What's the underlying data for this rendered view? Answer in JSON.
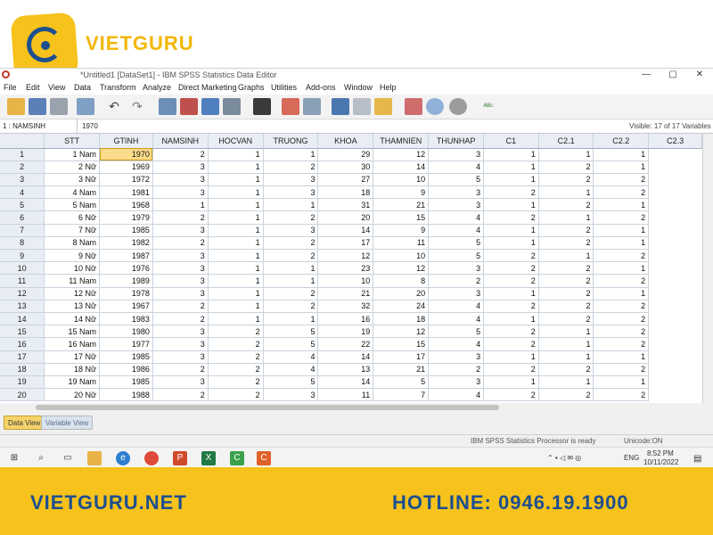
{
  "brand": {
    "name": "VIETGURU",
    "website": "VIETGURU.NET",
    "hotline": "HOTLINE: 0946.19.1900",
    "colors": {
      "yellow": "#f6c21b",
      "blue": "#1d4f8f"
    }
  },
  "window": {
    "title": "*Untitled1 [DataSet1] - IBM SPSS Statistics Data Editor",
    "controls": {
      "minimize": "—",
      "maximize": "▢",
      "close": "✕"
    }
  },
  "menu": [
    "File",
    "Edit",
    "View",
    "Data",
    "Transform",
    "Analyze",
    "Direct Marketing",
    "Graphs",
    "Utilities",
    "Add-ons",
    "Window",
    "Help"
  ],
  "toolbar_icons": [
    "open-folder-icon",
    "save-icon",
    "print-icon",
    "dialog-recall-icon",
    "undo-icon",
    "redo-icon",
    "goto-case-icon",
    "goto-variable-icon",
    "variables-icon",
    "run-descriptives-icon",
    "find-icon",
    "insert-cases-icon",
    "insert-variable-icon",
    "split-file-icon",
    "weight-cases-icon",
    "select-cases-icon",
    "value-labels-icon",
    "use-sets-icon",
    "show-all-icon",
    "spelling-icon"
  ],
  "cell_editor": {
    "reference": "1 : NAMSINH",
    "value": "1970",
    "visible_label": "Visible: 17 of 17 Variables"
  },
  "grid": {
    "columns": [
      "STT",
      "GTINH",
      "NAMSINH",
      "HOCVAN",
      "TRUONG",
      "KHOA",
      "THAMNIEN",
      "THUNHAP",
      "C1",
      "C2.1",
      "C2.2",
      "C2.3"
    ],
    "selected": {
      "row": 1,
      "column": "NAMSINH"
    },
    "rows": [
      [
        "1 Nam",
        "1970",
        "2",
        "1",
        "1",
        "29",
        "12",
        "3",
        "1",
        "1",
        "1"
      ],
      [
        "2 Nữ",
        "1969",
        "3",
        "1",
        "2",
        "30",
        "14",
        "4",
        "1",
        "2",
        "1"
      ],
      [
        "3 Nữ",
        "1972",
        "3",
        "1",
        "3",
        "27",
        "10",
        "5",
        "1",
        "2",
        "2"
      ],
      [
        "4 Nam",
        "1981",
        "3",
        "1",
        "3",
        "18",
        "9",
        "3",
        "2",
        "1",
        "2"
      ],
      [
        "5 Nam",
        "1968",
        "1",
        "1",
        "1",
        "31",
        "21",
        "3",
        "1",
        "2",
        "1"
      ],
      [
        "6 Nữ",
        "1979",
        "2",
        "1",
        "2",
        "20",
        "15",
        "4",
        "2",
        "1",
        "2"
      ],
      [
        "7 Nữ",
        "1985",
        "3",
        "1",
        "3",
        "14",
        "9",
        "4",
        "1",
        "2",
        "1"
      ],
      [
        "8 Nam",
        "1982",
        "2",
        "1",
        "2",
        "17",
        "11",
        "5",
        "1",
        "2",
        "1"
      ],
      [
        "9 Nữ",
        "1987",
        "3",
        "1",
        "2",
        "12",
        "10",
        "5",
        "2",
        "1",
        "2"
      ],
      [
        "10 Nữ",
        "1976",
        "3",
        "1",
        "1",
        "23",
        "12",
        "3",
        "2",
        "2",
        "1"
      ],
      [
        "11 Nam",
        "1989",
        "3",
        "1",
        "1",
        "10",
        "8",
        "2",
        "2",
        "2",
        "2"
      ],
      [
        "12 Nữ",
        "1978",
        "3",
        "1",
        "2",
        "21",
        "20",
        "3",
        "1",
        "2",
        "1"
      ],
      [
        "13 Nữ",
        "1967",
        "2",
        "1",
        "2",
        "32",
        "24",
        "4",
        "2",
        "2",
        "2"
      ],
      [
        "14 Nữ",
        "1983",
        "2",
        "1",
        "1",
        "16",
        "18",
        "4",
        "1",
        "2",
        "2"
      ],
      [
        "15 Nam",
        "1980",
        "3",
        "2",
        "5",
        "19",
        "12",
        "5",
        "2",
        "1",
        "2"
      ],
      [
        "16 Nam",
        "1977",
        "3",
        "2",
        "5",
        "22",
        "15",
        "4",
        "2",
        "1",
        "2"
      ],
      [
        "17 Nữ",
        "1985",
        "3",
        "2",
        "4",
        "14",
        "17",
        "3",
        "1",
        "1",
        "1"
      ],
      [
        "18 Nữ",
        "1986",
        "2",
        "2",
        "4",
        "13",
        "21",
        "2",
        "2",
        "2",
        "2"
      ],
      [
        "19 Nam",
        "1985",
        "3",
        "2",
        "5",
        "14",
        "5",
        "3",
        "1",
        "1",
        "1"
      ],
      [
        "20 Nữ",
        "1988",
        "2",
        "2",
        "3",
        "11",
        "7",
        "4",
        "2",
        "2",
        "2"
      ]
    ]
  },
  "tabs": {
    "data_view": "Data View",
    "variable_view": "Variable View"
  },
  "status": {
    "processor": "IBM SPSS Statistics Processor is ready",
    "unicode": "Unicode:ON"
  },
  "taskbar": {
    "apps": [
      "windows-start-icon",
      "search-icon",
      "task-view-icon",
      "file-explorer-icon",
      "edge-icon",
      "chrome-icon",
      "powerpoint-icon",
      "excel-icon",
      "camtasia-icon",
      "camtasia-recorder-icon"
    ],
    "tray_lang": "ENG",
    "tray_time": "8:52 PM",
    "tray_date": "10/11/2022"
  }
}
